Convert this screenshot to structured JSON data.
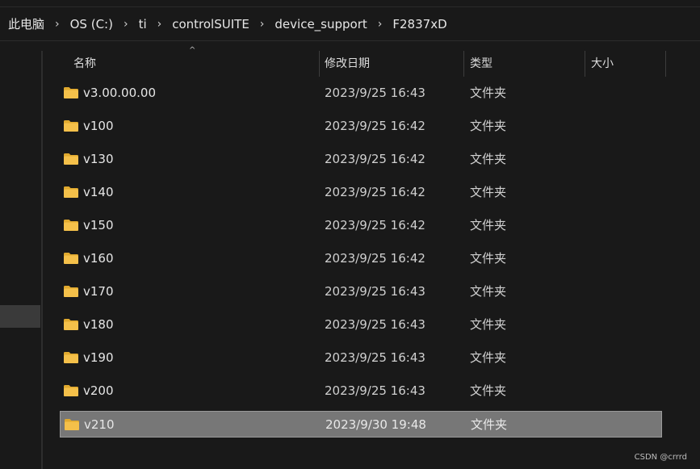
{
  "breadcrumb": [
    "此电脑",
    "OS (C:)",
    "ti",
    "controlSUITE",
    "device_support",
    "F2837xD"
  ],
  "separator": "›",
  "columns": {
    "name": "名称",
    "date": "修改日期",
    "type": "类型",
    "size": "大小"
  },
  "sort_indicator": "^",
  "rows": [
    {
      "name": "v3.00.00.00",
      "date": "2023/9/25 16:43",
      "type": "文件夹"
    },
    {
      "name": "v100",
      "date": "2023/9/25 16:42",
      "type": "文件夹"
    },
    {
      "name": "v130",
      "date": "2023/9/25 16:42",
      "type": "文件夹"
    },
    {
      "name": "v140",
      "date": "2023/9/25 16:42",
      "type": "文件夹"
    },
    {
      "name": "v150",
      "date": "2023/9/25 16:42",
      "type": "文件夹"
    },
    {
      "name": "v160",
      "date": "2023/9/25 16:42",
      "type": "文件夹"
    },
    {
      "name": "v170",
      "date": "2023/9/25 16:43",
      "type": "文件夹"
    },
    {
      "name": "v180",
      "date": "2023/9/25 16:43",
      "type": "文件夹"
    },
    {
      "name": "v190",
      "date": "2023/9/25 16:43",
      "type": "文件夹"
    },
    {
      "name": "v200",
      "date": "2023/9/25 16:43",
      "type": "文件夹"
    },
    {
      "name": "v210",
      "date": "2023/9/30 19:48",
      "type": "文件夹",
      "selected": true
    }
  ],
  "icons": {
    "folder": "folder-icon"
  },
  "colors": {
    "background": "#191919",
    "selected_row": "#777777",
    "folder": "#f4c04a"
  },
  "watermark": "CSDN @crrrd"
}
